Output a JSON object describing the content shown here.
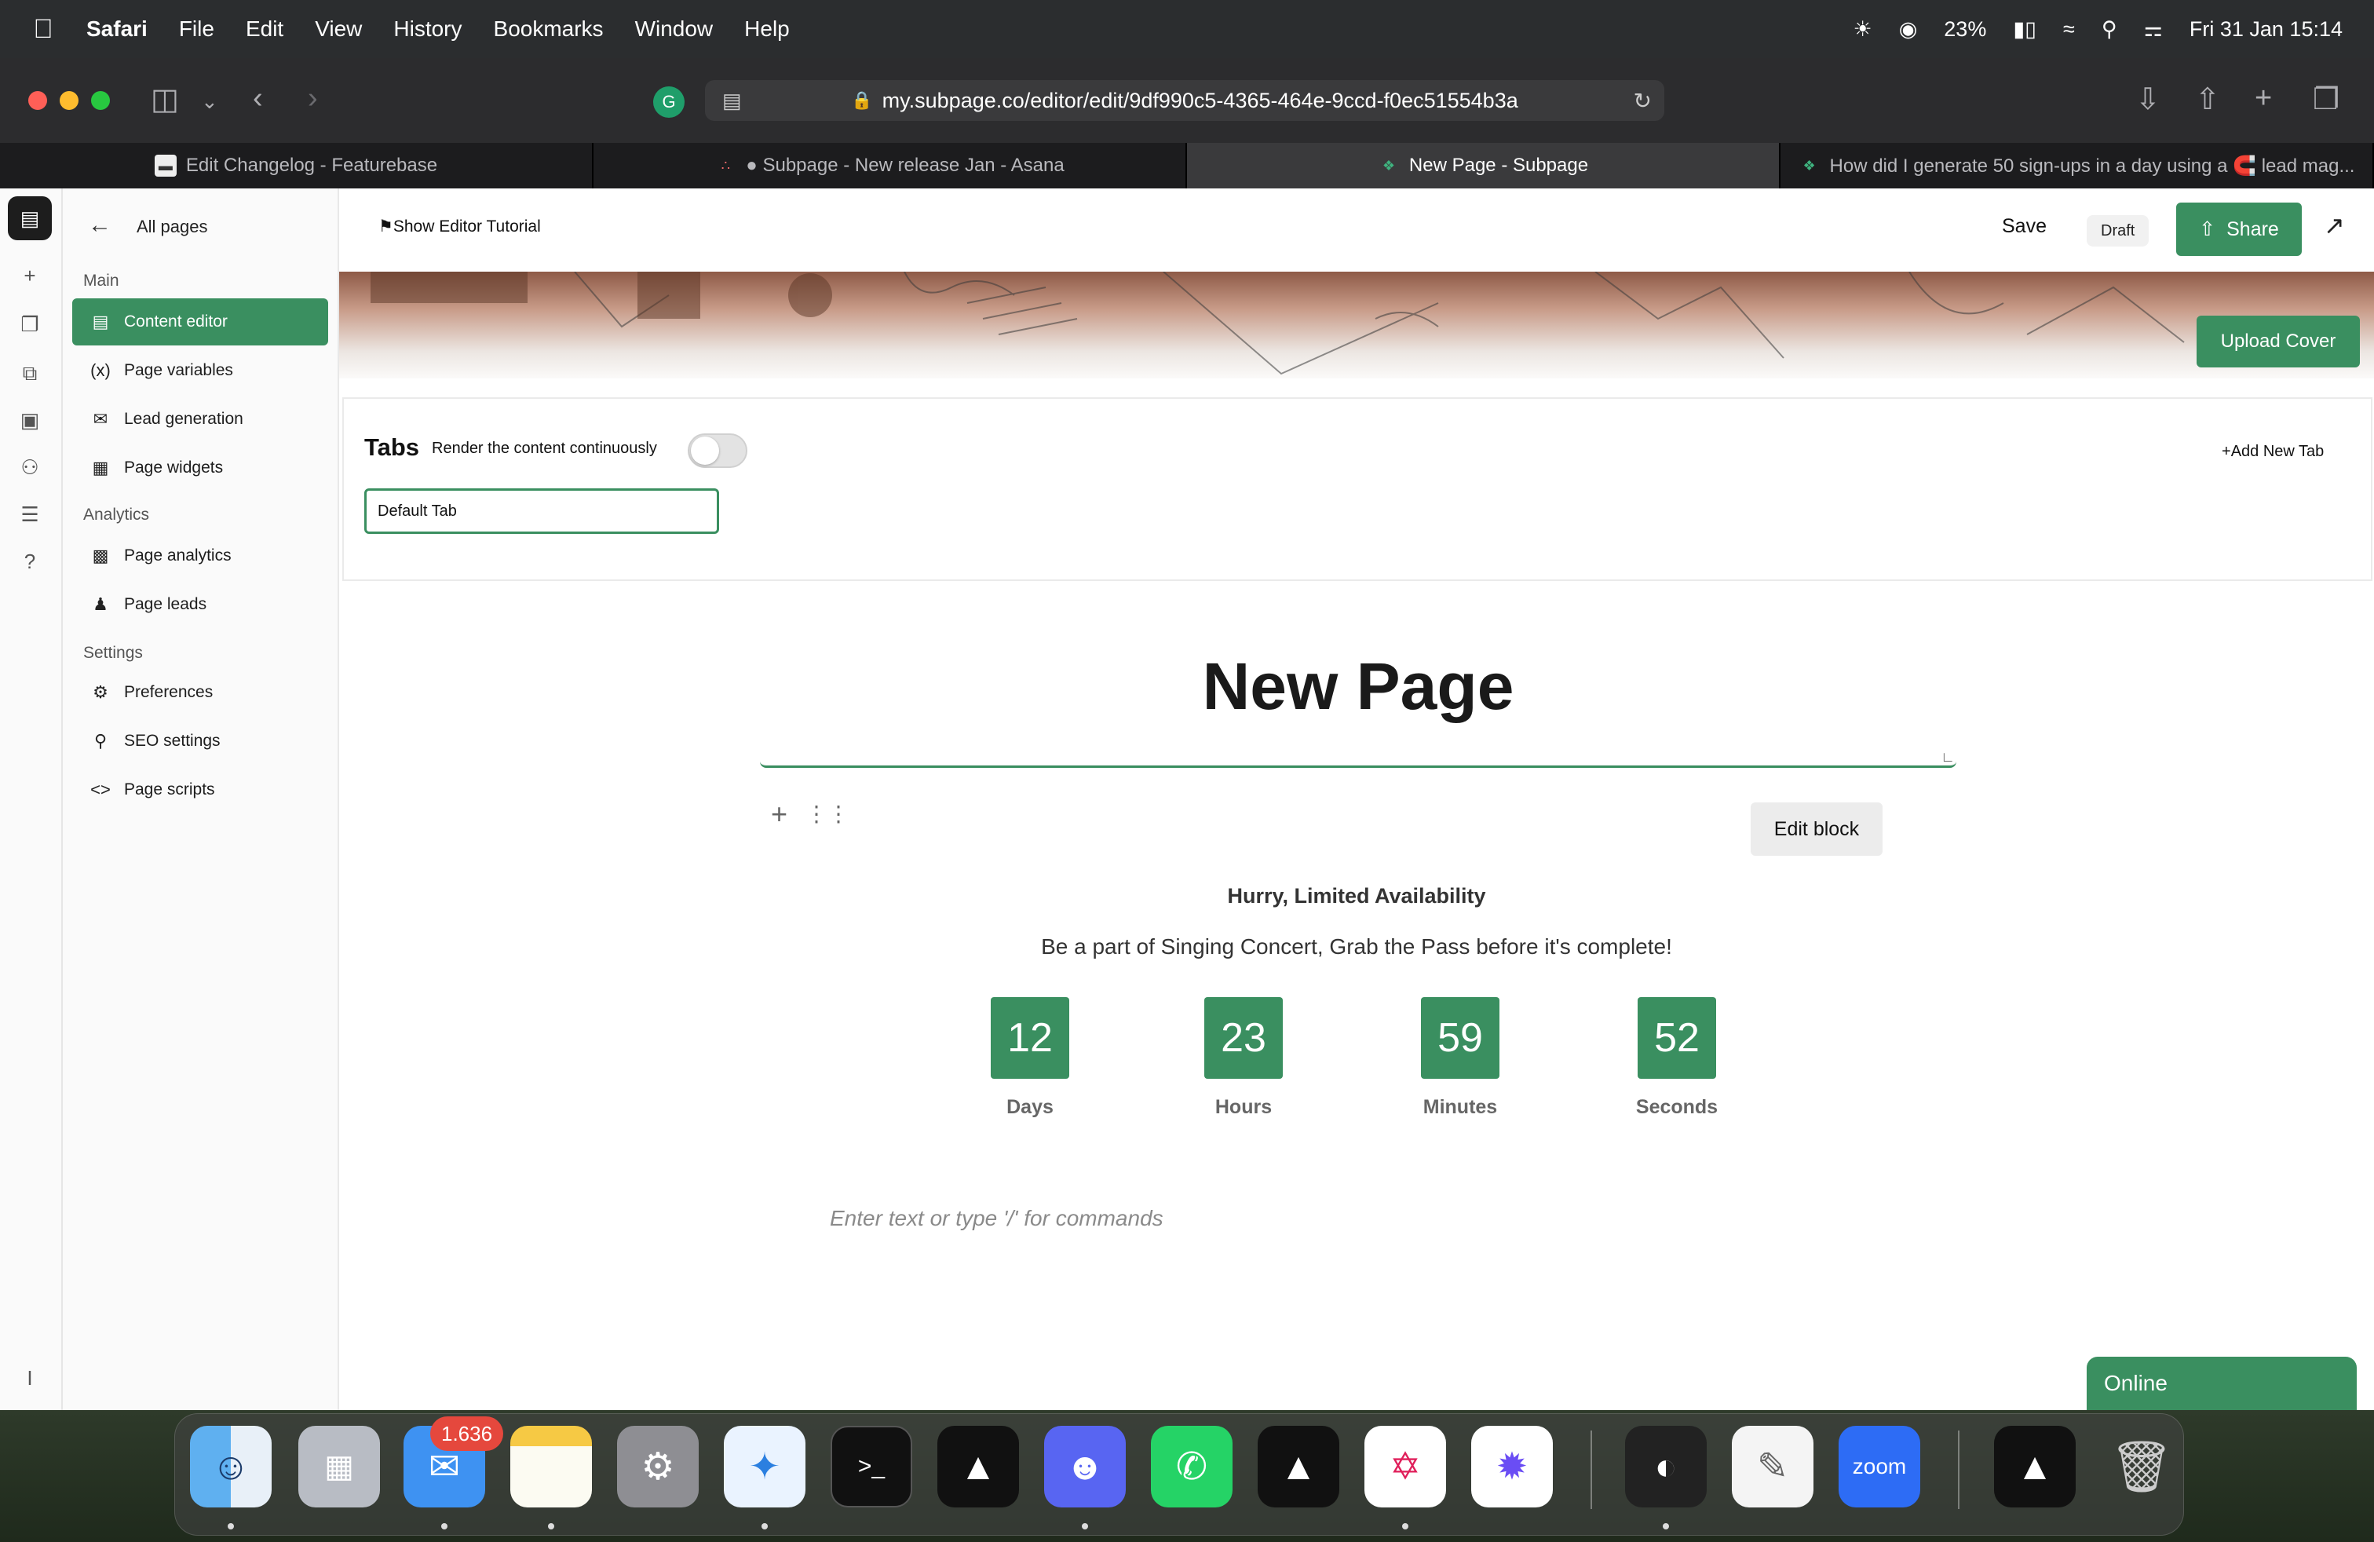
{
  "menubar": {
    "app": "Safari",
    "menus": [
      "File",
      "Edit",
      "View",
      "History",
      "Bookmarks",
      "Window",
      "Help"
    ],
    "battery": "23%",
    "datetime": "Fri 31 Jan  15:14"
  },
  "browser": {
    "url": "my.subpage.co/editor/edit/9df990c5-4365-464e-9ccd-f0ec51554b3a",
    "tabs": [
      {
        "title": "Edit Changelog - Featurebase",
        "active": false
      },
      {
        "title": "● Subpage - New release Jan - Asana",
        "active": false
      },
      {
        "title": "New Page - Subpage",
        "active": true
      },
      {
        "title": "How did I generate 50 sign-ups in a day using a 🧲 lead mag...",
        "active": false
      }
    ]
  },
  "sidebar": {
    "back_label": "All pages",
    "sections": {
      "main": "Main",
      "analytics": "Analytics",
      "settings": "Settings"
    },
    "items": [
      {
        "label": "Content editor",
        "icon": "document-icon"
      },
      {
        "label": "Page variables",
        "icon": "variable-icon"
      },
      {
        "label": "Lead generation",
        "icon": "envelope-icon"
      },
      {
        "label": "Page widgets",
        "icon": "widgets-icon"
      },
      {
        "label": "Page analytics",
        "icon": "chart-icon"
      },
      {
        "label": "Page leads",
        "icon": "people-icon"
      },
      {
        "label": "Preferences",
        "icon": "gear-icon"
      },
      {
        "label": "SEO settings",
        "icon": "search-icon"
      },
      {
        "label": "Page scripts",
        "icon": "code-icon"
      }
    ]
  },
  "editor": {
    "tutorial": "Show Editor Tutorial",
    "save": "Save",
    "status": "Draft",
    "share": "Share",
    "upload_cover": "Upload Cover",
    "tabs_title": "Tabs",
    "tabs_subtitle": "Render the content continuously",
    "add_tab": "Add New Tab",
    "default_tab": "Default Tab",
    "page_title": "New Page",
    "edit_block": "Edit block",
    "placeholder": "Enter text or type '/' for commands",
    "online": "Online"
  },
  "countdown": {
    "heading": "Hurry, Limited Availability",
    "subheading": "Be a part of Singing Concert, Grab the Pass before it's complete!",
    "units": [
      {
        "value": "12",
        "label": "Days"
      },
      {
        "value": "23",
        "label": "Hours"
      },
      {
        "value": "59",
        "label": "Minutes"
      },
      {
        "value": "52",
        "label": "Seconds"
      }
    ]
  },
  "dock": {
    "mail_badge": "1.636",
    "zoom_label": "zoom",
    "apps": [
      "finder-icon",
      "launchpad-icon",
      "mail-icon",
      "notes-icon",
      "system-settings-icon",
      "safari-icon",
      "terminal-icon",
      "app-icon",
      "discord-icon",
      "whatsapp-icon",
      "app-icon",
      "slack-icon",
      "app-icon",
      "app-icon",
      "textedit-icon",
      "zoom-icon",
      "app-icon",
      "trash-icon"
    ]
  },
  "colors": {
    "accent": "#3a8f60",
    "menubar": "#2b2d2f"
  }
}
